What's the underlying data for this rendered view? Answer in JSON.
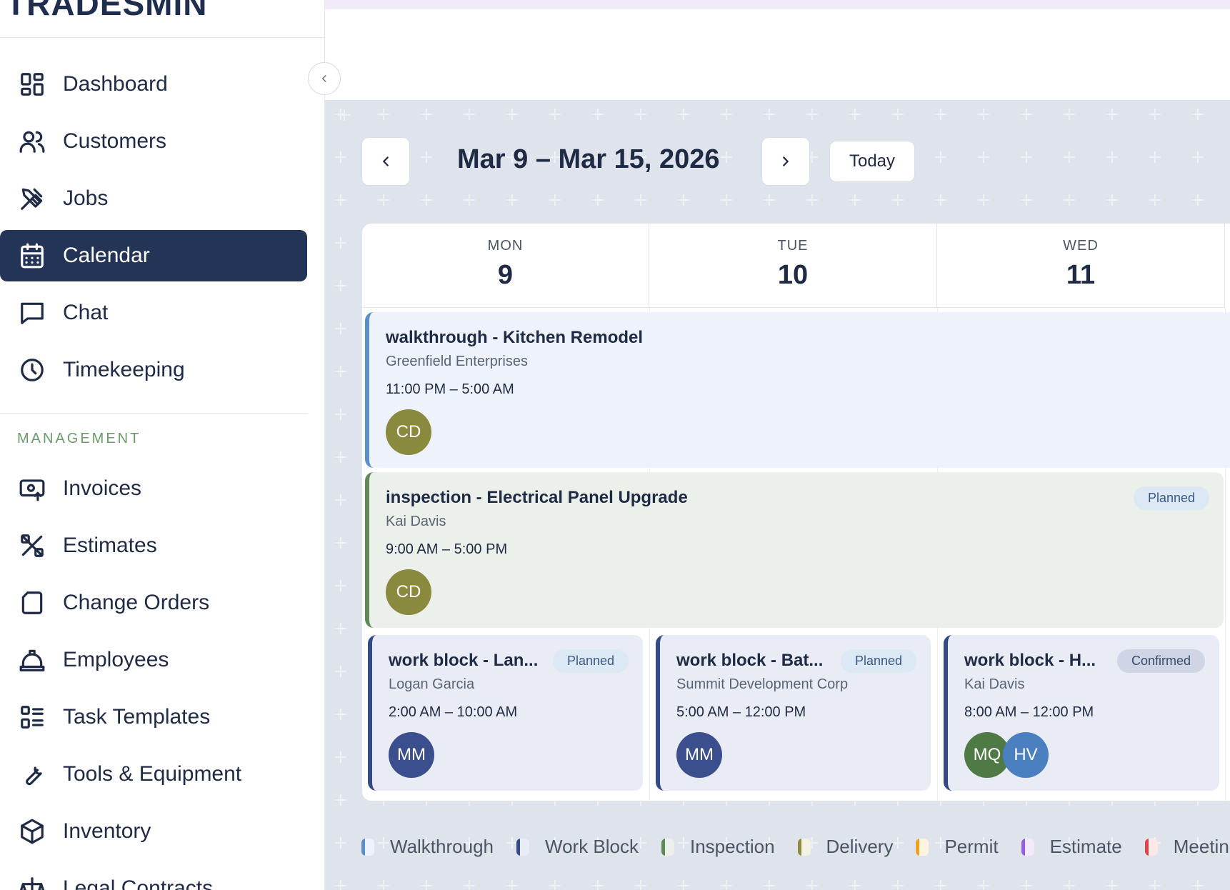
{
  "app": {
    "logo_text": "TRADESMIN"
  },
  "sidebar": {
    "items": [
      {
        "label": "Dashboard",
        "icon": "dashboard-icon"
      },
      {
        "label": "Customers",
        "icon": "users-icon"
      },
      {
        "label": "Jobs",
        "icon": "tools-icon"
      },
      {
        "label": "Calendar",
        "icon": "calendar-icon",
        "active": true
      },
      {
        "label": "Chat",
        "icon": "chat-icon"
      },
      {
        "label": "Timekeeping",
        "icon": "clock-icon"
      }
    ],
    "section_label": "MANAGEMENT",
    "management_items": [
      {
        "label": "Invoices",
        "icon": "invoice-icon"
      },
      {
        "label": "Estimates",
        "icon": "estimate-icon"
      },
      {
        "label": "Change Orders",
        "icon": "document-icon"
      },
      {
        "label": "Employees",
        "icon": "hardhat-icon"
      },
      {
        "label": "Task Templates",
        "icon": "list-icon"
      },
      {
        "label": "Tools & Equipment",
        "icon": "wrench-icon"
      },
      {
        "label": "Inventory",
        "icon": "box-icon"
      },
      {
        "label": "Legal Contracts",
        "icon": "scale-icon"
      }
    ]
  },
  "calendar": {
    "range_title": "Mar 9 – Mar 15, 2026",
    "today_label": "Today",
    "days": [
      {
        "dow": "MON",
        "num": "9"
      },
      {
        "dow": "TUE",
        "num": "10"
      },
      {
        "dow": "WED",
        "num": "11"
      }
    ],
    "events": {
      "walkthrough": {
        "title": "walkthrough - Kitchen Remodel",
        "customer": "Greenfield Enterprises",
        "time": "11:00 PM – 5:00 AM",
        "avatars": [
          "CD"
        ]
      },
      "inspection": {
        "title": "inspection - Electrical Panel Upgrade",
        "customer": "Kai Davis",
        "time": "9:00 AM – 5:00 PM",
        "avatars": [
          "CD"
        ],
        "status": "Planned"
      },
      "work1": {
        "title": "work block - Lan...",
        "customer": "Logan Garcia",
        "time": "2:00 AM – 10:00 AM",
        "avatars": [
          "MM"
        ],
        "status": "Planned"
      },
      "work2": {
        "title": "work block - Bat...",
        "customer": "Summit Development Corp",
        "time": "5:00 AM – 12:00 PM",
        "avatars": [
          "MM"
        ],
        "status": "Planned"
      },
      "work3": {
        "title": "work block - H...",
        "customer": "Kai Davis",
        "time": "8:00 AM – 12:00 PM",
        "avatars": [
          "MQ",
          "HV"
        ],
        "status": "Confirmed"
      }
    },
    "legend": [
      {
        "label": "Walkthrough",
        "color": "#5b8fc7",
        "bg": "#eef3fb"
      },
      {
        "label": "Work Block",
        "color": "#334a86",
        "bg": "#e9ecf4"
      },
      {
        "label": "Inspection",
        "color": "#5f8a57",
        "bg": "#ecf0ea"
      },
      {
        "label": "Delivery",
        "color": "#8c8a3f",
        "bg": "#f3f2e4"
      },
      {
        "label": "Permit",
        "color": "#f0a020",
        "bg": "#fdf4e2"
      },
      {
        "label": "Estimate",
        "color": "#9a5ce0",
        "bg": "#f2eafb"
      },
      {
        "label": "Meeting",
        "color": "#e0454a",
        "bg": "#fbe9ea"
      }
    ]
  }
}
